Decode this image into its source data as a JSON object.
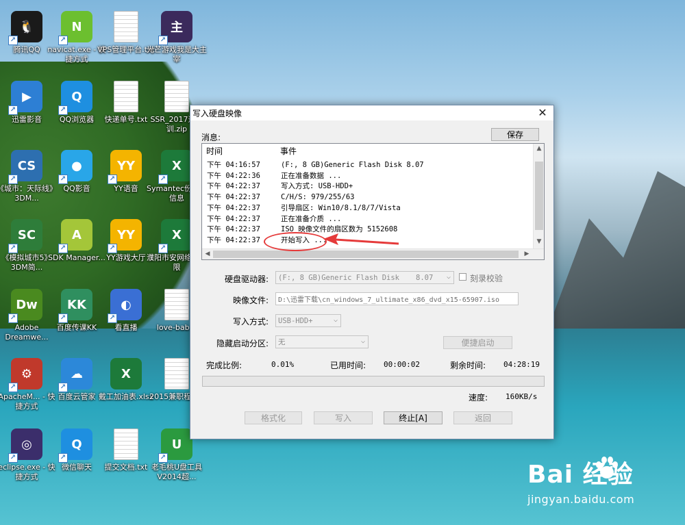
{
  "desktop_icons": [
    {
      "label": "腾讯QQ",
      "color": "#1a1a1a",
      "glyph": "🐧",
      "shortcut": true
    },
    {
      "label": "navicat.exe - 快捷方式",
      "color": "#6cbf2f",
      "glyph": "N",
      "shortcut": true
    },
    {
      "label": "VPS管理平台.txt",
      "color": "#f3f3f3",
      "glyph": "",
      "shortcut": false
    },
    {
      "label": "光芒游戏我是大主宰",
      "color": "#3b2a5c",
      "glyph": "主",
      "shortcut": true
    },
    {
      "label": "迅雷影音",
      "color": "#2d7fd4",
      "glyph": "▶",
      "shortcut": true
    },
    {
      "label": "QQ浏览器",
      "color": "#1e8fe0",
      "glyph": "Q",
      "shortcut": true
    },
    {
      "label": "快递单号.txt",
      "color": "#f3f3f3",
      "glyph": "",
      "shortcut": false
    },
    {
      "label": "SSR_2017道场训.zip",
      "color": "#f3f3f3",
      "glyph": "",
      "shortcut": false
    },
    {
      "label": "《城市：天际线》3DM...",
      "color": "#2d6fb0",
      "glyph": "CS",
      "shortcut": true
    },
    {
      "label": "QQ影音",
      "color": "#29a6e8",
      "glyph": "●",
      "shortcut": true
    },
    {
      "label": "YY语音",
      "color": "#f4b400",
      "glyph": "YY",
      "shortcut": true
    },
    {
      "label": "Symantec份软件信息",
      "color": "#1d7a3a",
      "glyph": "X",
      "shortcut": true
    },
    {
      "label": "《模拟城市5》3DM简...",
      "color": "#2e7d3a",
      "glyph": "SC",
      "shortcut": true
    },
    {
      "label": "SDK Manager...",
      "color": "#a4c639",
      "glyph": "A",
      "shortcut": true
    },
    {
      "label": "YY游戏大厅",
      "color": "#f4b400",
      "glyph": "YY",
      "shortcut": true
    },
    {
      "label": "濮阳市安网络技有限",
      "color": "#1d7a3a",
      "glyph": "X",
      "shortcut": true
    },
    {
      "label": "Adobe Dreamwe...",
      "color": "#4a8a1f",
      "glyph": "Dw",
      "shortcut": true
    },
    {
      "label": "百度传课KK",
      "color": "#2f8f5f",
      "glyph": "KK",
      "shortcut": true
    },
    {
      "label": "看直播",
      "color": "#3a6fd4",
      "glyph": "◐",
      "shortcut": true
    },
    {
      "label": "love-bab...",
      "color": "#f3efe6",
      "glyph": "",
      "shortcut": false
    },
    {
      "label": "ApacheM... - 快捷方式",
      "color": "#c0392b",
      "glyph": "⚙",
      "shortcut": true
    },
    {
      "label": "百度云管家",
      "color": "#2c88d9",
      "glyph": "☁",
      "shortcut": true
    },
    {
      "label": "戴工加油表.xlsx",
      "color": "#1d7a3a",
      "glyph": "X",
      "shortcut": false
    },
    {
      "label": "2015兼职程.txt",
      "color": "#f3f3f3",
      "glyph": "",
      "shortcut": false
    },
    {
      "label": "eclipse.exe - 快捷方式",
      "color": "#3b2e6b",
      "glyph": "◎",
      "shortcut": true
    },
    {
      "label": "微信聊天",
      "color": "#1e8fe0",
      "glyph": "Q",
      "shortcut": true
    },
    {
      "label": "提交文档.txt",
      "color": "#f3f3f3",
      "glyph": "",
      "shortcut": false
    },
    {
      "label": "老毛桃U盘工具V2014超...",
      "color": "#2b9a3f",
      "glyph": "U",
      "shortcut": true
    }
  ],
  "dialog": {
    "title": "写入硬盘映像",
    "close": "✕",
    "messages_label": "消息:",
    "save_button": "保存",
    "log": {
      "col_time": "时间",
      "col_event": "事件",
      "rows": [
        {
          "time": "下午 04:16:57",
          "event": "(F:, 8 GB)Generic Flash Disk     8.07"
        },
        {
          "time": "下午 04:22:36",
          "event": "正在准备数据 ..."
        },
        {
          "time": "下午 04:22:37",
          "event": "写入方式: USB-HDD+"
        },
        {
          "time": "下午 04:22:37",
          "event": "C/H/S: 979/255/63"
        },
        {
          "time": "下午 04:22:37",
          "event": "引导扇区: Win10/8.1/8/7/Vista"
        },
        {
          "time": "下午 04:22:37",
          "event": "正在准备介质 ..."
        },
        {
          "time": "下午 04:22:37",
          "event": "ISO 映像文件的扇区数为 5152608"
        },
        {
          "time": "下午 04:22:37",
          "event": "开始写入 ..."
        }
      ]
    },
    "drive_label": "硬盘驱动器:",
    "drive_value": "(F:, 8 GB)Generic Flash Disk",
    "drive_version": "8.07",
    "verify_label": "刻录校验",
    "image_label": "映像文件:",
    "image_value": "D:\\迅雷下载\\cn_windows_7_ultimate_x86_dvd_x15-65907.iso",
    "write_mode_label": "写入方式:",
    "write_mode_value": "USB-HDD+",
    "hidden_partition_label": "隐藏启动分区:",
    "hidden_partition_value": "无",
    "quick_boot_button": "便捷启动",
    "percent_label": "完成比例:",
    "percent_value": "0.01%",
    "elapsed_label": "已用时间:",
    "elapsed_value": "00:00:02",
    "remaining_label": "剩余时间:",
    "remaining_value": "04:28:19",
    "progress_fraction": 0.0001,
    "speed_label": "速度:",
    "speed_value": "160KB/s",
    "buttons": {
      "format": "格式化",
      "write": "写入",
      "stop": "终止[A]",
      "back": "返回"
    }
  },
  "watermark": {
    "logo": "Bai  经验",
    "url": "jingyan.baidu.com"
  },
  "colors": {
    "annotation_red": "#e53a3a",
    "progress_green": "#06b025"
  }
}
